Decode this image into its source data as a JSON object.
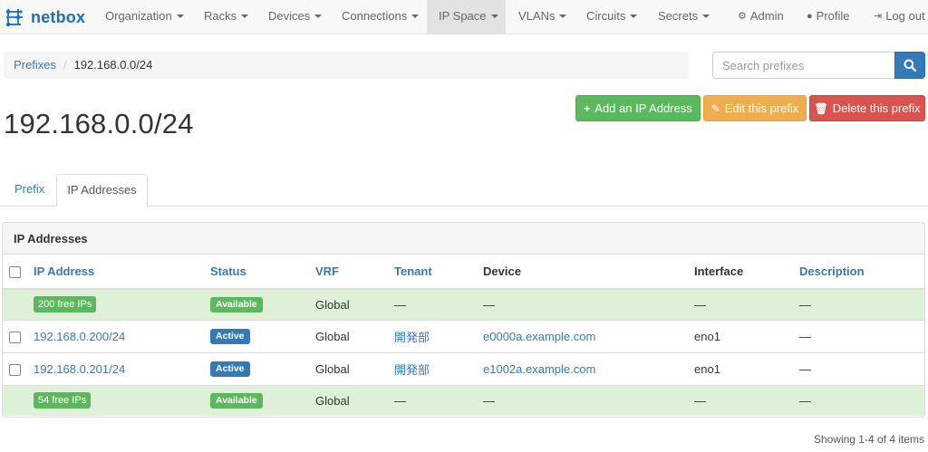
{
  "navbar": {
    "brand": "netbox",
    "items": [
      {
        "label": "Organization",
        "dropdown": true
      },
      {
        "label": "Racks",
        "dropdown": true
      },
      {
        "label": "Devices",
        "dropdown": true
      },
      {
        "label": "Connections",
        "dropdown": true
      },
      {
        "label": "IP Space",
        "dropdown": true,
        "active": true
      },
      {
        "label": "VLANs",
        "dropdown": true
      },
      {
        "label": "Circuits",
        "dropdown": true
      },
      {
        "label": "Secrets",
        "dropdown": true
      }
    ],
    "right": [
      {
        "label": "Admin",
        "icon": "gears-icon"
      },
      {
        "label": "Profile",
        "icon": "user-icon"
      },
      {
        "label": "Log out",
        "icon": "logout-icon"
      }
    ]
  },
  "breadcrumb": {
    "parent": "Prefixes",
    "current": "192.168.0.0/24"
  },
  "search": {
    "placeholder": "Search prefixes",
    "icon": "search-icon"
  },
  "actions": {
    "add": "Add an IP Address",
    "edit": "Edit this prefix",
    "delete": "Delete this prefix"
  },
  "page_title": "192.168.0.0/24",
  "tabs": {
    "prefix": "Prefix",
    "ip_addresses": "IP Addresses"
  },
  "panel": {
    "heading": "IP Addresses",
    "columns": {
      "ip": "IP Address",
      "status": "Status",
      "vrf": "VRF",
      "tenant": "Tenant",
      "device": "Device",
      "interface": "Interface",
      "description": "Description"
    },
    "rows": [
      {
        "type": "available",
        "ip": "200 free IPs",
        "status": "Available",
        "vrf": "Global",
        "tenant": "—",
        "device": "—",
        "interface": "—",
        "description": "—"
      },
      {
        "type": "ip",
        "ip": "192.168.0.200/24",
        "status": "Active",
        "vrf": "Global",
        "tenant": "開発部",
        "device": "e0000a.example.com",
        "interface": "eno1",
        "description": "—"
      },
      {
        "type": "ip",
        "ip": "192.168.0.201/24",
        "status": "Active",
        "vrf": "Global",
        "tenant": "開発部",
        "device": "e1002a.example.com",
        "interface": "eno1",
        "description": "—"
      },
      {
        "type": "available",
        "ip": "54 free IPs",
        "status": "Available",
        "vrf": "Global",
        "tenant": "—",
        "device": "—",
        "interface": "—",
        "description": "—"
      }
    ]
  },
  "footer": "Showing 1-4 of 4 items",
  "colors": {
    "primary": "#337ab7",
    "success": "#5cb85c",
    "warning": "#f0ad4e",
    "danger": "#d9534f"
  }
}
